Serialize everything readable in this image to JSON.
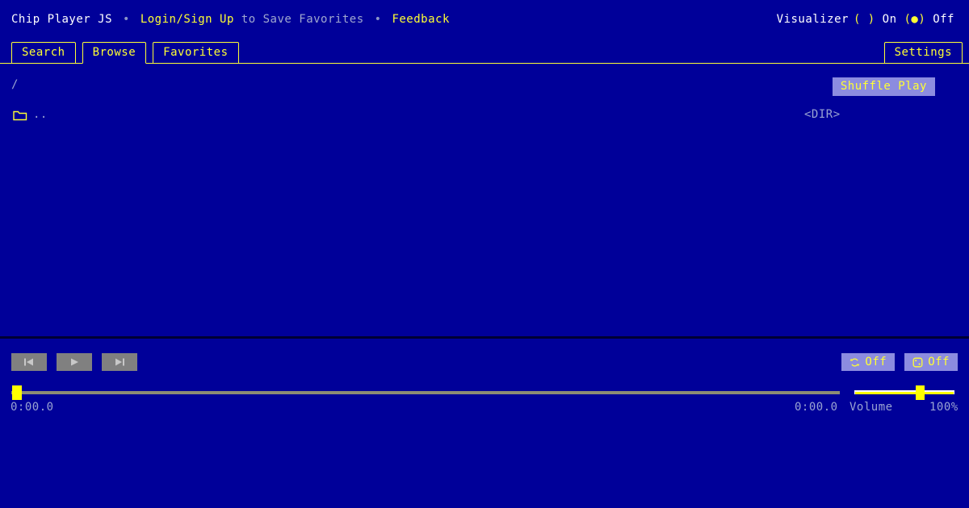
{
  "app": {
    "background_color": "#000099",
    "accent_color": "#ffff33",
    "button_color": "#8c8ce0",
    "dim_color": "#9aa4d2"
  },
  "header": {
    "title": "Chip Player JS",
    "bullet": "•",
    "login_link": "Login/Sign Up",
    "login_suffix": "to Save Favorites",
    "feedback_link": "Feedback",
    "visualizer": {
      "label": "Visualizer",
      "on_radio": "( )",
      "on_label": "On",
      "off_radio": "(●)",
      "off_label": "Off",
      "selected": "Off"
    }
  },
  "tabs": {
    "items": [
      {
        "label": "Search",
        "active": false
      },
      {
        "label": "Browse",
        "active": true
      },
      {
        "label": "Favorites",
        "active": false
      }
    ],
    "settings_label": "Settings"
  },
  "browse": {
    "breadcrumb": "/",
    "shuffle_play_label": "Shuffle Play",
    "rows": [
      {
        "icon": "folder-icon",
        "name": "..",
        "type": "<DIR>"
      }
    ]
  },
  "player": {
    "transport": {
      "prev_icon": "skip-previous-icon",
      "play_icon": "play-icon",
      "next_icon": "skip-next-icon"
    },
    "repeat": {
      "icon": "repeat-icon",
      "label": "Off"
    },
    "shuffle": {
      "icon": "shuffle-dice-icon",
      "label": "Off"
    },
    "seek": {
      "current_time": "0:00.0",
      "total_time": "0:00.0",
      "progress_percent": 0
    },
    "volume": {
      "label": "Volume",
      "value": "100%",
      "percent": 62
    }
  }
}
